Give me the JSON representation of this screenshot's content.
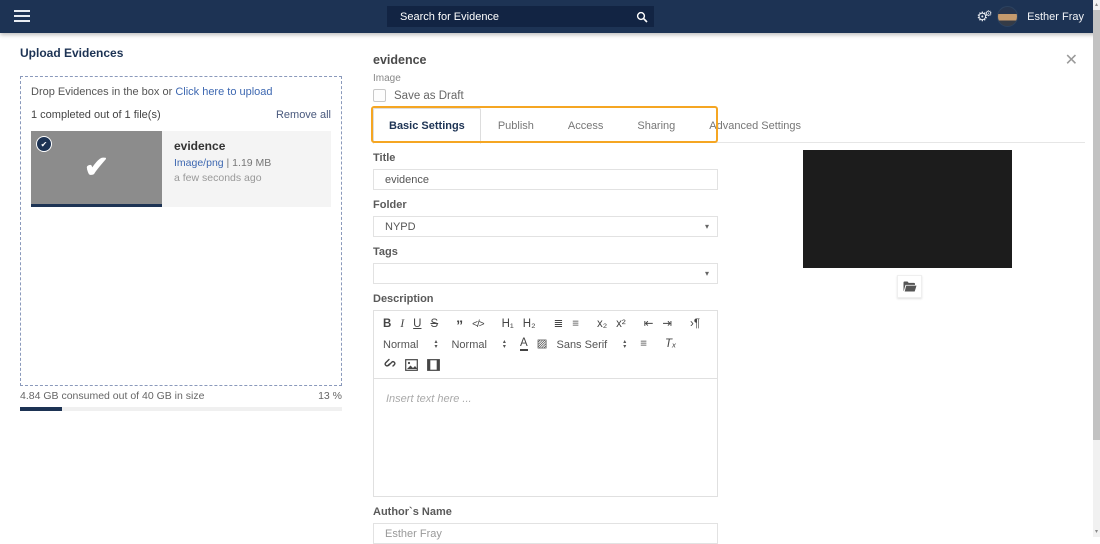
{
  "navbar": {
    "search_value": "Search for Evidence",
    "user_name": "Esther Fray"
  },
  "upload_panel": {
    "title": "Upload Evidences",
    "drop_text": "Drop Evidences in the box or ",
    "drop_link_label": "Click here to upload",
    "completed_text": "1 completed out of 1 file(s)",
    "remove_all_label": "Remove all",
    "file": {
      "name": "evidence",
      "type": "Image/png",
      "size": " | 1.19 MB",
      "uploaded_time": "a few seconds ago"
    },
    "storage_text": "4.84 GB consumed out of 40 GB in size",
    "storage_percent_label": "13 %",
    "storage_percent_value": 13
  },
  "detail_panel": {
    "title": "evidence",
    "subtitle": "Image",
    "save_as_draft_label": "Save as Draft",
    "tabs": [
      {
        "label": "Basic Settings",
        "active": true
      },
      {
        "label": "Publish",
        "active": false
      },
      {
        "label": "Access",
        "active": false
      },
      {
        "label": "Sharing",
        "active": false
      },
      {
        "label": "Advanced Settings",
        "active": false
      }
    ],
    "form": {
      "title_label": "Title",
      "title_value": "evidence",
      "folder_label": "Folder",
      "folder_value": "NYPD",
      "tags_label": "Tags",
      "tags_value": "",
      "description_label": "Description",
      "description_placeholder": "Insert text here ...",
      "author_label": "Author`s Name",
      "author_value": "Esther Fray"
    },
    "editor": {
      "size_select": "Normal",
      "header_select": "Normal",
      "font_select": "Sans Serif"
    }
  },
  "icons": {
    "check": "✔",
    "badge_check": "✔",
    "close": "✕",
    "gear": "⚙",
    "gear_small": "⚙",
    "bold": "B",
    "italic": "I",
    "underline": "U",
    "strike": "S",
    "blockquote": "”",
    "code_block": "</>",
    "header_1": "H₁",
    "header_2": "H₂",
    "list_ordered": "≣",
    "list_bullet": "≡",
    "subscript": "x₂",
    "superscript": "x²",
    "outdent": "⇤",
    "indent": "⇥",
    "direction": "›¶",
    "text_color": "A",
    "background_color": "▨",
    "align": "≡",
    "clean_format": "Tₓ",
    "caret_down": "▾",
    "arrow_up": "▴",
    "arrow_down": "▾"
  },
  "colors": {
    "navy": "#1d3354",
    "search_navy": "#122443",
    "highlight_orange": "#f5a623",
    "link_blue": "#3e68b1",
    "thumb_gray": "#8c8c8c"
  }
}
